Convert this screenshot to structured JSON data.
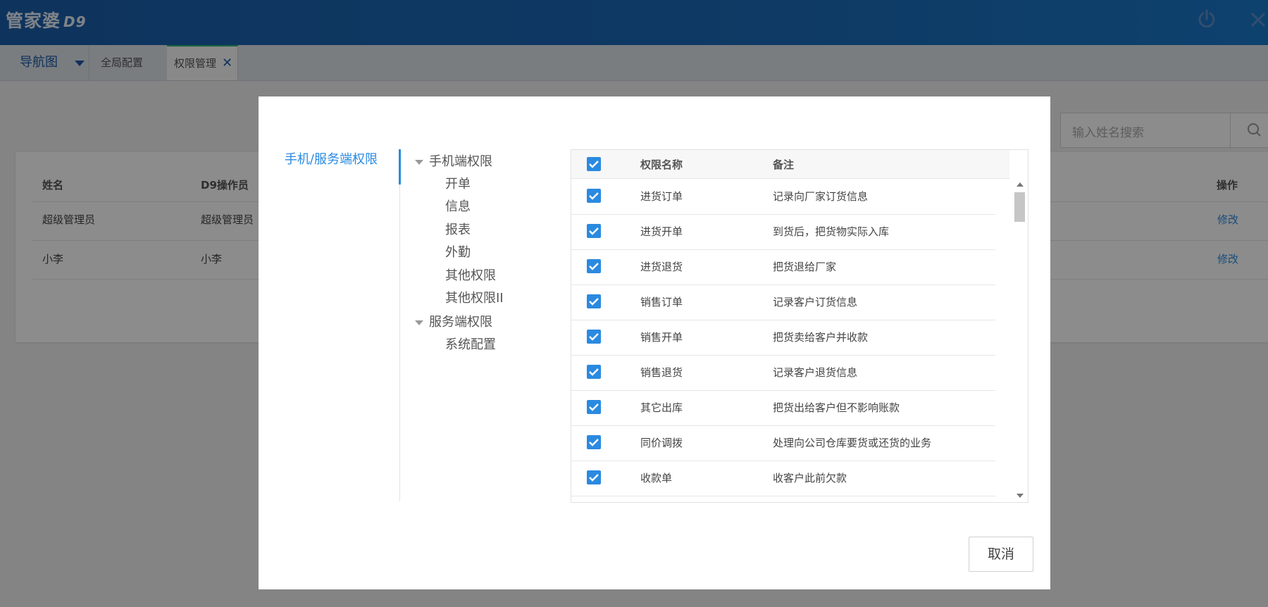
{
  "app": {
    "logo_text": "管家婆",
    "logo_suffix": "D9"
  },
  "tabs": {
    "nav_label": "导航图",
    "global_label": "全局配置",
    "perm_label": "权限管理",
    "perm_close": "✕"
  },
  "background": {
    "search_placeholder": "输入姓名搜索",
    "headers": {
      "name": "姓名",
      "operator": "D9操作员",
      "action": "操作"
    },
    "rows": [
      {
        "name": "超级管理员",
        "operator": "超级管理员",
        "action": "修改"
      },
      {
        "name": "小李",
        "operator": "小李",
        "action": "修改"
      }
    ]
  },
  "modal": {
    "left_nav": "手机/服务端权限",
    "tree": {
      "mobile": "手机端权限",
      "mobile_children": [
        "开单",
        "信息",
        "报表",
        "外勤",
        "其他权限",
        "其他权限II"
      ],
      "server": "服务端权限",
      "server_children": [
        "系统配置"
      ]
    },
    "table": {
      "headers": {
        "name": "权限名称",
        "note": "备注"
      },
      "rows": [
        {
          "name": "进货订单",
          "note": "记录向厂家订货信息",
          "checked": true
        },
        {
          "name": "进货开单",
          "note": "到货后，把货物实际入库",
          "checked": true
        },
        {
          "name": "进货退货",
          "note": "把货退给厂家",
          "checked": true
        },
        {
          "name": "销售订单",
          "note": "记录客户订货信息",
          "checked": true
        },
        {
          "name": "销售开单",
          "note": "把货卖给客户并收款",
          "checked": true
        },
        {
          "name": "销售退货",
          "note": "记录客户退货信息",
          "checked": true
        },
        {
          "name": "其它出库",
          "note": "把货出给客户但不影响账款",
          "checked": true
        },
        {
          "name": "同价调拨",
          "note": "处理向公司仓库要货或还货的业务",
          "checked": true
        },
        {
          "name": "收款单",
          "note": "收客户此前欠款",
          "checked": true
        }
      ]
    },
    "cancel_label": "取消"
  },
  "colors": {
    "accent": "#2a8ae0",
    "header_blue": "#1a6ab8",
    "active_tab_line": "#2bb673"
  }
}
